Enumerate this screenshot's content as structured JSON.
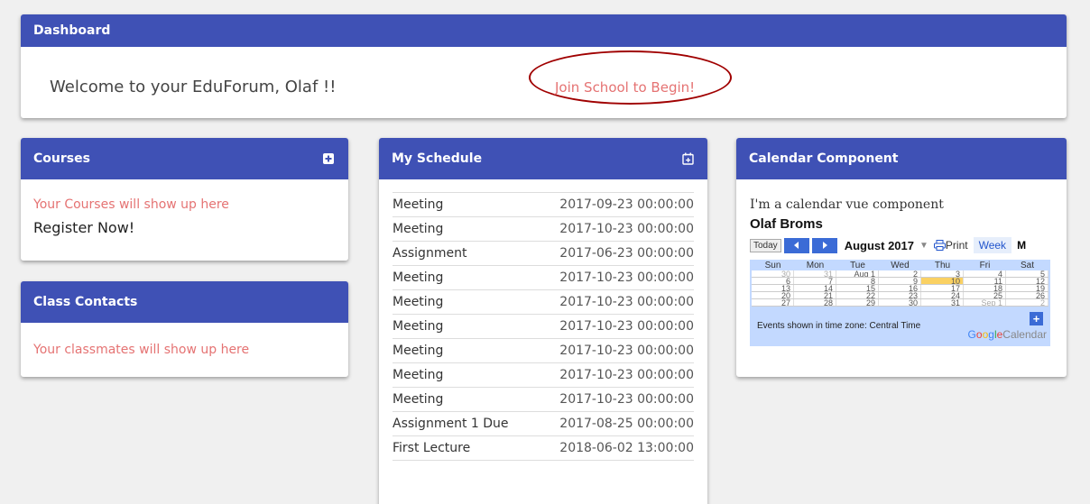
{
  "dashboard": {
    "title": "Dashboard",
    "welcome": "Welcome to your EduForum, Olaf !!",
    "join_link": "Join School to Begin!"
  },
  "courses": {
    "title": "Courses",
    "add_icon": "plus-square-icon",
    "empty_text": "Your Courses will show up here",
    "register": "Register Now!"
  },
  "contacts": {
    "title": "Class Contacts",
    "empty_text": "Your classmates will show up here"
  },
  "schedule": {
    "title": "My Schedule",
    "calendar_icon": "calendar-add-icon",
    "rows": [
      {
        "name": "Meeting",
        "date": "2017-09-23 00:00:00"
      },
      {
        "name": "Meeting",
        "date": "2017-10-23 00:00:00"
      },
      {
        "name": "Assignment",
        "date": "2017-06-23 00:00:00"
      },
      {
        "name": "Meeting",
        "date": "2017-10-23 00:00:00"
      },
      {
        "name": "Meeting",
        "date": "2017-10-23 00:00:00"
      },
      {
        "name": "Meeting",
        "date": "2017-10-23 00:00:00"
      },
      {
        "name": "Meeting",
        "date": "2017-10-23 00:00:00"
      },
      {
        "name": "Meeting",
        "date": "2017-10-23 00:00:00"
      },
      {
        "name": "Meeting",
        "date": "2017-10-23 00:00:00"
      },
      {
        "name": "Assignment 1 Due",
        "date": "2017-08-25 00:00:00"
      },
      {
        "name": "First Lecture",
        "date": "2018-06-02 13:00:00"
      }
    ]
  },
  "calendar": {
    "title": "Calendar Component",
    "intro": "I'm a calendar vue component",
    "owner": "Olaf Broms",
    "today_btn": "Today",
    "month": "August 2017",
    "print": "Print",
    "tab_week": "Week",
    "tab_month": "M",
    "days": [
      "Sun",
      "Mon",
      "Tue",
      "Wed",
      "Thu",
      "Fri",
      "Sat"
    ],
    "weeks": [
      [
        "30",
        "31",
        "Aug 1",
        "2",
        "3",
        "4",
        "5"
      ],
      [
        "6",
        "7",
        "8",
        "9",
        "10",
        "11",
        "12"
      ],
      [
        "13",
        "14",
        "15",
        "16",
        "17",
        "18",
        "19"
      ],
      [
        "20",
        "21",
        "22",
        "23",
        "24",
        "25",
        "26"
      ],
      [
        "27",
        "28",
        "29",
        "30",
        "31",
        "Sep 1",
        "2"
      ]
    ],
    "timezone_note": "Events shown in time zone: Central Time",
    "brand": "Google",
    "brand_suffix": "Calendar"
  },
  "colors": {
    "header": "#3f51b5",
    "accent_text": "#e57373",
    "annotation_circle": "#a00000",
    "today_highlight": "#fad163"
  }
}
